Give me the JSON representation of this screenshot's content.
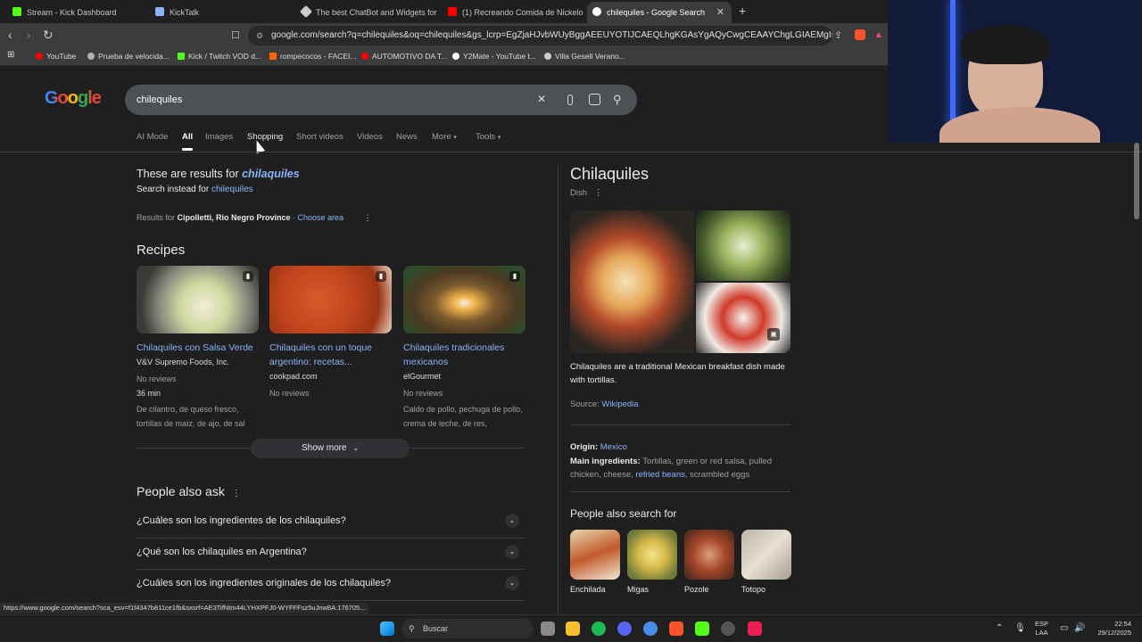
{
  "browser": {
    "tabs": [
      {
        "label": "Stream - Kick Dashboard",
        "color": "#53fc18"
      },
      {
        "label": "KickTalk",
        "color": "#8ab4f8"
      },
      {
        "label": "The best ChatBot and Widgets for Ki",
        "color": "#cccccc"
      },
      {
        "label": "(1) Recreando Comida de Nickelodeo",
        "color": "#ff0000"
      },
      {
        "label": "chilequiles - Google Search",
        "color": "#4285f4"
      }
    ],
    "url": "google.com/search?q=chilequiles&oq=chilequiles&gs_lcrp=EgZjaHJvbWUyBggAEEUYOTIJCAEQLhgKGAsYgAQyCwgCEAAYChgLGIAEMgIsAxAAGAoY...",
    "bookmarks": [
      {
        "label": "YouTube",
        "color": "#ff0000"
      },
      {
        "label": "Prueba de velocida...",
        "color": "#b0b0b0"
      },
      {
        "label": "Kick / Twitch VOD d...",
        "color": "#53fc18"
      },
      {
        "label": "rompecocos - FACEI...",
        "color": "#ff6600"
      },
      {
        "label": "AUTOMOTIVO DA T...",
        "color": "#ff0000"
      },
      {
        "label": "Y2Mate - YouTube t...",
        "color": "#ffffff"
      },
      {
        "label": "Villa Gesell Verano...",
        "color": "#cccccc"
      }
    ],
    "status_url": "https://www.google.com/search?sca_esv=f1f4347b811ce1fb&sxsrf=AE3TifNtm44LYHXPFJ0-WYFFFsz5uJnw8A:176705..."
  },
  "search": {
    "logo": "Google",
    "query": "chilequiles",
    "tabs": [
      "AI Mode",
      "All",
      "Images",
      "Shopping",
      "Short videos",
      "Videos",
      "News",
      "More",
      "Tools"
    ],
    "active_tab": "All"
  },
  "results": {
    "correction_prefix": "These are results for ",
    "correction": "chilaquiles",
    "instead_prefix": "Search instead for ",
    "instead": "chilequiles",
    "location_prefix": "Results for ",
    "location": "Cipolletti, Rio Negro Province",
    "choose_area": "Choose area",
    "recipes_heading": "Recipes",
    "recipes": [
      {
        "title": "Chilaquiles con Salsa Verde",
        "source": "V&V Supremo Foods, Inc.",
        "reviews": "No reviews",
        "time": "36 min",
        "ingredients": "De cilantro, de queso fresco, tortillas de maíz, de ajo, de sal"
      },
      {
        "title": "Chilaquiles con un toque argentino: recetas...",
        "source": "cookpad.com",
        "reviews": "No reviews",
        "time": "",
        "ingredients": ""
      },
      {
        "title": "Chilaquiles tradicionales mexicanos",
        "source": "elGourmet",
        "reviews": "No reviews",
        "time": "",
        "ingredients": "Caldo de pollo, pechuga de pollo, crema de leche, de res,"
      }
    ],
    "show_more": "Show more",
    "paa_heading": "People also ask",
    "paa": [
      "¿Cuáles son los ingredientes de los chilaquiles?",
      "¿Qué son los chilaquiles en Argentina?",
      "¿Cuáles son los ingredientes originales de los chilaquiles?"
    ]
  },
  "knowledge": {
    "title": "Chilaquiles",
    "subtitle": "Dish",
    "description": "Chilaquiles are a traditional Mexican breakfast dish made with tortillas.",
    "source_label": "Source: ",
    "source": "Wikipedia",
    "origin_label": "Origin: ",
    "origin": "Mexico",
    "ingredients_label": "Main ingredients: ",
    "ingredients_1": "Tortillas, green or red salsa, pulled chicken, cheese, ",
    "ingredients_link": "refried beans",
    "ingredients_2": ", scrambled eggs",
    "pas_heading": "People also search for",
    "pas": [
      "Enchilada",
      "Migas",
      "Pozole",
      "Totopo"
    ]
  },
  "taskbar": {
    "search_placeholder": "Buscar",
    "lang_1": "ESP",
    "lang_2": "LAA",
    "time": "22:54",
    "date": "29/12/2025"
  }
}
